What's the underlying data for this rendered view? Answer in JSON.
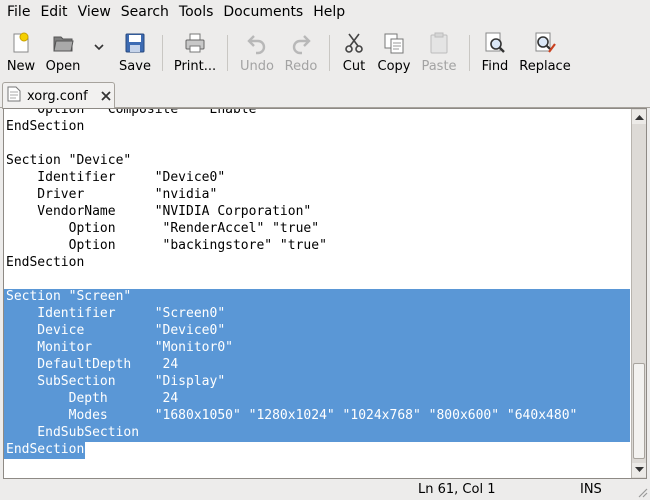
{
  "menubar": {
    "items": [
      "File",
      "Edit",
      "View",
      "Search",
      "Tools",
      "Documents",
      "Help"
    ]
  },
  "toolbar": {
    "new": "New",
    "open": "Open",
    "save": "Save",
    "print": "Print...",
    "undo": "Undo",
    "redo": "Redo",
    "cut": "Cut",
    "copy": "Copy",
    "paste": "Paste",
    "find": "Find",
    "replace": "Replace"
  },
  "tab": {
    "filename": "xorg.conf"
  },
  "editor": {
    "lines": [
      "    Option  \"Composite\"  \"Enable\"",
      "EndSection",
      "",
      "Section \"Device\"",
      "    Identifier     \"Device0\"",
      "    Driver         \"nvidia\"",
      "    VendorName     \"NVIDIA Corporation\"",
      "        Option      \"RenderAccel\" \"true\"",
      "        Option      \"backingstore\" \"true\"",
      "EndSection",
      "",
      "Section \"Screen\"",
      "    Identifier     \"Screen0\"",
      "    Device         \"Device0\"",
      "    Monitor        \"Monitor0\"",
      "    DefaultDepth    24",
      "    SubSection     \"Display\"",
      "        Depth       24",
      "        Modes      \"1680x1050\" \"1280x1024\" \"1024x768\" \"800x600\" \"640x480\"",
      "    EndSubSection",
      "EndSection"
    ],
    "selected_from_line": 12,
    "selected_to_line": 21
  },
  "statusbar": {
    "position": "Ln 61, Col 1",
    "mode": "INS"
  }
}
